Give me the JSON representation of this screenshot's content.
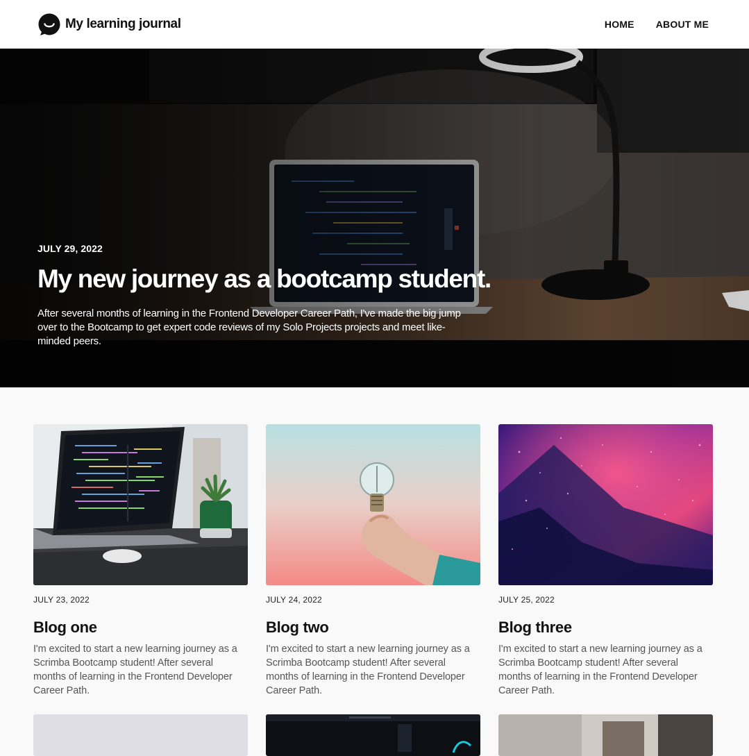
{
  "header": {
    "brand_name": "My learning journal",
    "nav": [
      {
        "label": "HOME"
      },
      {
        "label": "ABOUT ME"
      }
    ]
  },
  "hero": {
    "date": "JULY 29, 2022",
    "title": "My new journey as a bootcamp student.",
    "description": "After several months of learning in the Frontend Developer Career Path, I've made the big jump over to the Bootcamp to get expert code reviews of my Solo Projects projects and meet like-minded peers."
  },
  "posts": [
    {
      "date": "JULY 23, 2022",
      "title": "Blog one",
      "excerpt": "I'm excited to start a new learning journey as a Scrimba Bootcamp student! After several months of learning in the Frontend Developer Career Path."
    },
    {
      "date": "JULY 24, 2022",
      "title": "Blog two",
      "excerpt": "I'm excited to start a new learning journey as a Scrimba Bootcamp student! After several months of learning in the Frontend Developer Career Path."
    },
    {
      "date": "JULY 25, 2022",
      "title": "Blog three",
      "excerpt": "I'm excited to start a new learning journey as a Scrimba Bootcamp student! After several months of learning in the Frontend Developer Career Path."
    }
  ],
  "colors": {
    "header_bg": "#ffffff",
    "page_bg": "#f9f9f9",
    "text": "#111111",
    "muted_text": "#555555"
  }
}
